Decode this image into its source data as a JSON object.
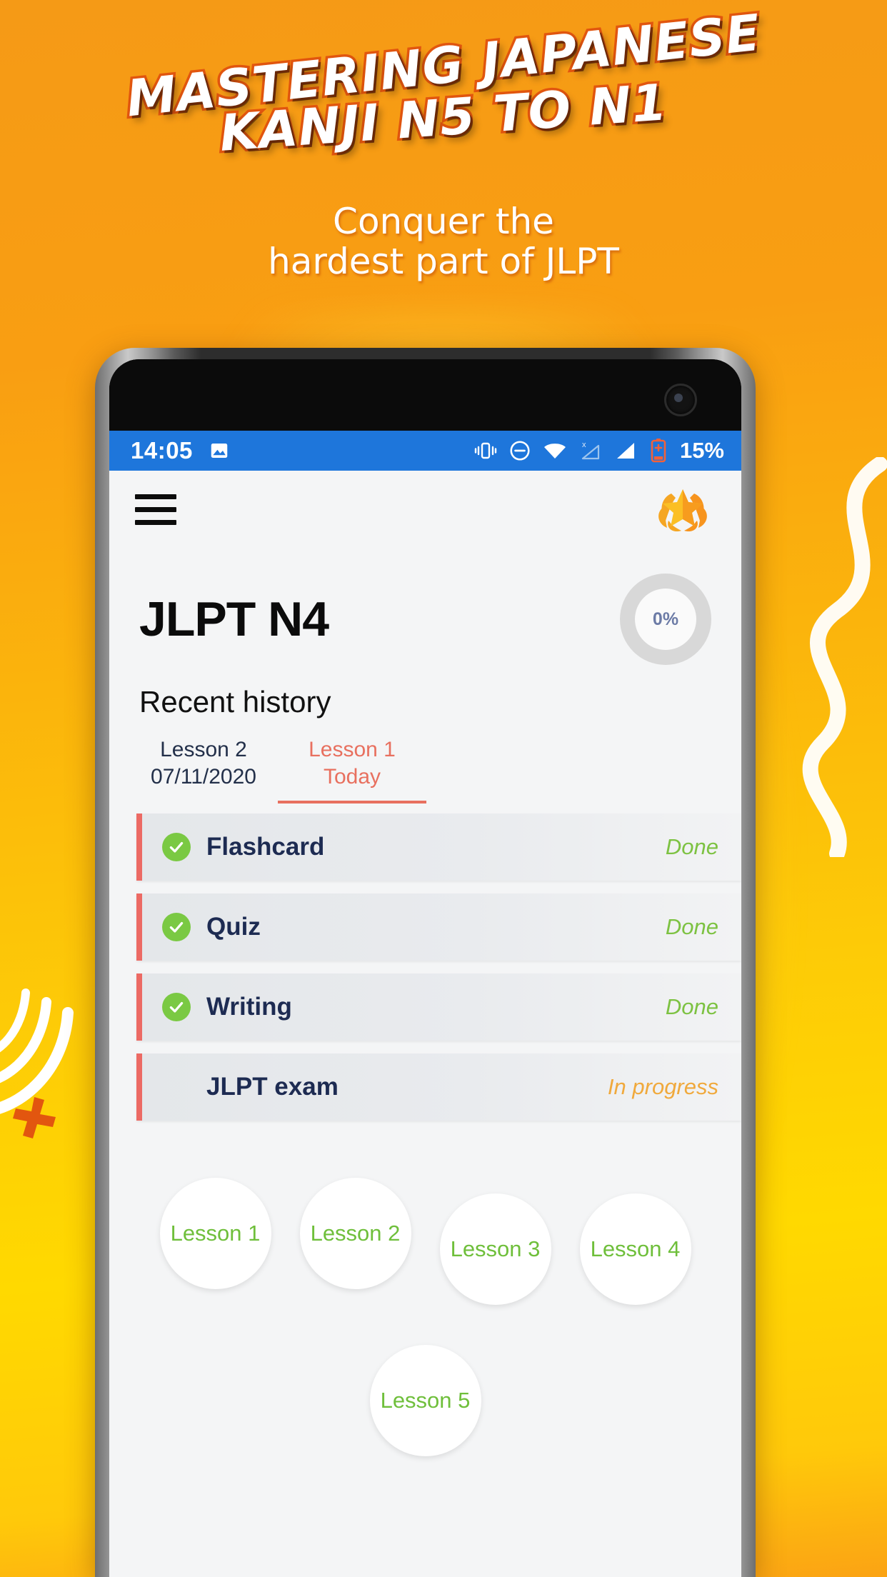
{
  "promo": {
    "headline_line1": "MASTERING JAPANESE",
    "headline_line2": "KANJI N5 TO N1",
    "subtitle_line1": "Conquer the",
    "subtitle_line2": "hardest part of JLPT",
    "colors": {
      "background_top": "#F59A16",
      "background_bottom": "#FFD900",
      "headline_fill": "#FFFFFF",
      "headline_outline": "#E2560F"
    }
  },
  "statusbar": {
    "time": "14:05",
    "battery_percent": "15%",
    "icons": [
      "image-icon",
      "vibrate-icon",
      "do-not-disturb-icon",
      "wifi-icon",
      "no-sim-signal-icon",
      "cellular-signal-icon",
      "battery-icon"
    ],
    "background": "#1E76DB"
  },
  "appbar": {
    "menu_icon": "hamburger-menu-icon",
    "trophy_icon": "laurel-star-trophy-icon"
  },
  "main": {
    "page_title": "JLPT N4",
    "progress_percent": "0%",
    "section_title": "Recent history",
    "tabs": [
      {
        "label": "Lesson  2",
        "sub": "07/11/2020",
        "active": false
      },
      {
        "label": "Lesson  1",
        "sub": "Today",
        "active": true
      }
    ],
    "rows": [
      {
        "label": "Flashcard",
        "status": "Done",
        "state": "done"
      },
      {
        "label": "Quiz",
        "status": "Done",
        "state": "done"
      },
      {
        "label": "Writing",
        "status": "Done",
        "state": "done"
      },
      {
        "label": "JLPT exam",
        "status": "In progress",
        "state": "progress"
      }
    ],
    "lessons": [
      "Lesson 1",
      "Lesson 2",
      "Lesson 3",
      "Lesson 4",
      "Lesson 5"
    ],
    "colors": {
      "row_accent": "#EC6A64",
      "done": "#7DC242",
      "in_progress": "#F0A93C",
      "label": "#1D2B52",
      "tab_active": "#E8705F",
      "lesson_text": "#6FBF3B"
    }
  }
}
